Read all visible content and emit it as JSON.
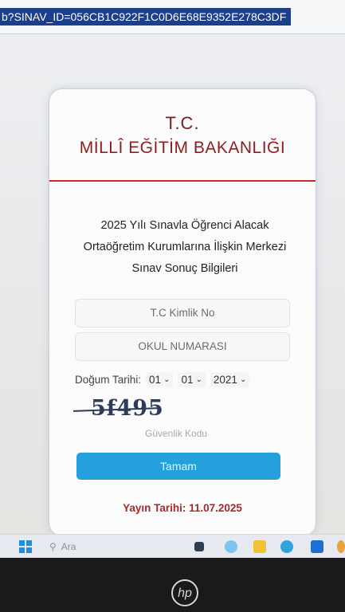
{
  "browser": {
    "url_fragment": "b?SINAV_ID=056CB1C922F1C0D6E68E9352E278C3DF"
  },
  "card": {
    "heading_tc": "T.C.",
    "heading_ministry": "MİLLÎ EĞİTİM BAKANLIĞI",
    "info_lines": [
      "2025 Yılı Sınavla Öğrenci Alacak",
      "Ortaöğretim Kurumlarına İlişkin Merkezi",
      "Sınav Sonuç Bilgileri"
    ],
    "tc_placeholder": "T.C Kimlik No",
    "school_placeholder": "OKUL NUMARASI",
    "dob_label": "Doğum Tarihi:",
    "dob_day": "01",
    "dob_month": "01",
    "dob_year": "2021",
    "captcha_text": "5f495",
    "security_label": "Güvenlik Kodu",
    "submit_label": "Tamam",
    "publish_date": "Yayın Tarihi: 11.07.2025"
  },
  "taskbar": {
    "search_text": "Ara"
  },
  "device": {
    "logo_text": "hp"
  },
  "colors": {
    "accent_button": "#24a0dd",
    "ministry_red": "#c62828",
    "url_selection": "#1d3e8a"
  }
}
